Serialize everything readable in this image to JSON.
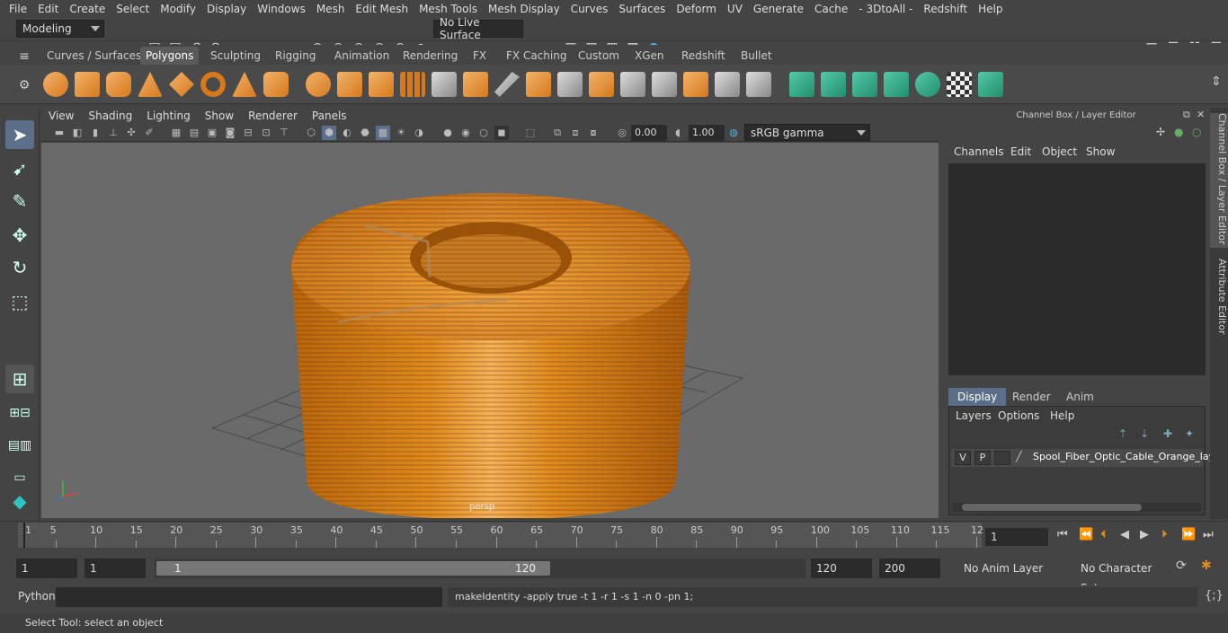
{
  "menubar": [
    "File",
    "Edit",
    "Create",
    "Select",
    "Modify",
    "Display",
    "Windows",
    "Mesh",
    "Edit Mesh",
    "Mesh Tools",
    "Mesh Display",
    "Curves",
    "Surfaces",
    "Deform",
    "UV",
    "Generate",
    "Cache",
    "- 3DtoAll -",
    "Redshift",
    "Help"
  ],
  "status": {
    "mode": "Modeling",
    "live_surface": "No Live Surface"
  },
  "shelf_tabs": [
    "Curves / Surfaces",
    "Polygons",
    "Sculpting",
    "Rigging",
    "Animation",
    "Rendering",
    "FX",
    "FX Caching",
    "Custom",
    "XGen",
    "Redshift",
    "Bullet"
  ],
  "active_shelf_tab": "Polygons",
  "viewport": {
    "menu": [
      "View",
      "Shading",
      "Lighting",
      "Show",
      "Renderer",
      "Panels"
    ],
    "exposure": "0.00",
    "gamma": "1.00",
    "colorspace": "sRGB gamma",
    "camera_label": "persp"
  },
  "channel_box": {
    "title": "Channel Box / Layer Editor",
    "menu": [
      "Channels",
      "Edit",
      "Object",
      "Show"
    ]
  },
  "layer_editor": {
    "tabs": [
      "Display",
      "Render",
      "Anim"
    ],
    "active_tab": "Display",
    "menu": [
      "Layers",
      "Options",
      "Help"
    ],
    "layer": {
      "v": "V",
      "p": "P",
      "name": "Spool_Fiber_Optic_Cable_Orange_lay"
    }
  },
  "side_tabs": [
    "Channel Box / Layer Editor",
    "Attribute Editor"
  ],
  "timeline": {
    "ticks": [
      "1",
      "5",
      "10",
      "15",
      "20",
      "25",
      "30",
      "35",
      "40",
      "45",
      "50",
      "55",
      "60",
      "65",
      "70",
      "75",
      "80",
      "85",
      "90",
      "95",
      "100",
      "105",
      "110",
      "115",
      "12"
    ],
    "current_frame": "1"
  },
  "range": {
    "start": "1",
    "playback_start": "1",
    "slider_start": "1",
    "slider_end": "120",
    "playback_end": "120",
    "end": "200",
    "anim_layer": "No Anim Layer",
    "character_set": "No Character Set"
  },
  "command": {
    "language": "Python",
    "result": "makeIdentity -apply true -t 1 -r 1 -s 1 -n 0 -pn 1;"
  },
  "help_line": "Select Tool: select an object"
}
